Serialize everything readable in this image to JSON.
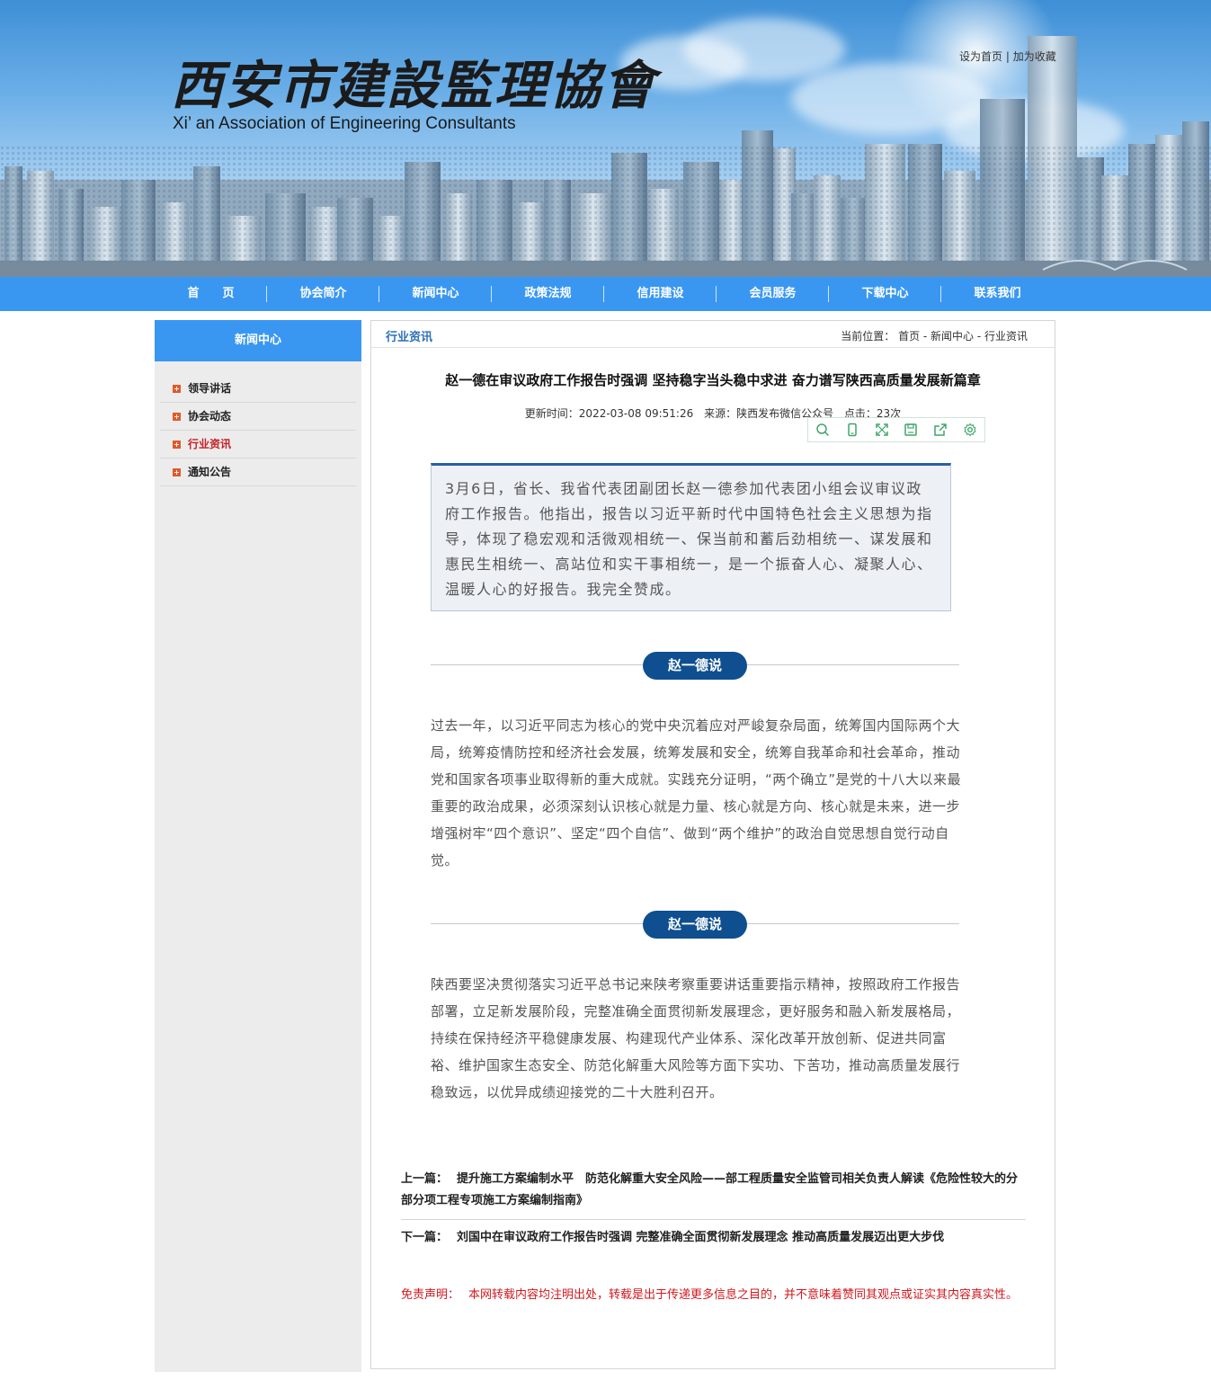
{
  "header": {
    "logo_cn": "西安市建設監理協會",
    "logo_en": "Xi’  an Association of Engineering Consultants",
    "set_home": "设为首页",
    "separator": "|",
    "add_favorite": "加为收藏"
  },
  "nav": {
    "items": [
      "首　　页",
      "协会简介",
      "新闻中心",
      "政策法规",
      "信用建设",
      "会员服务",
      "下载中心",
      "联系我们"
    ]
  },
  "sidebar": {
    "title": "新闻中心",
    "items": [
      {
        "label": "领导讲话",
        "active": false
      },
      {
        "label": "协会动态",
        "active": false
      },
      {
        "label": "行业资讯",
        "active": true
      },
      {
        "label": "通知公告",
        "active": false
      }
    ]
  },
  "main": {
    "section_title": "行业资讯",
    "breadcrumb": "当前位置：  首页 - 新闻中心 - 行业资讯"
  },
  "article": {
    "title": "赵一德在审议政府工作报告时强调 坚持稳字当头稳中求进 奋力谱写陕西高质量发展新篇章",
    "updated": "更新时间：2022-03-08 09:51:26",
    "source": "来源：陕西发布微信公众号",
    "clicks": "点击：23次",
    "lead": "3月6日，省长、我省代表团副团长赵一德参加代表团小组会议审议政府工作报告。他指出，报告以习近平新时代中国特色社会主义思想为指导，体现了稳宏观和活微观相统一、保当前和蓄后劲相统一、谋发展和惠民生相统一、高站位和实干事相统一，是一个振奋人心、凝聚人心、温暖人心的好报告。我完全赞成。",
    "section1_label": "赵一德说",
    "para1": "过去一年，以习近平同志为核心的党中央沉着应对严峻复杂局面，统筹国内国际两个大局，统筹疫情防控和经济社会发展，统筹发展和安全，统筹自我革命和社会革命，推动党和国家各项事业取得新的重大成就。实践充分证明，“两个确立”是党的十八大以来最重要的政治成果，必须深刻认识核心就是力量、核心就是方向、核心就是未来，进一步增强树牢“四个意识”、坚定“四个自信”、做到“两个维护”的政治自觉思想自觉行动自觉。",
    "section2_label": "赵一德说",
    "para2": "陕西要坚决贯彻落实习近平总书记来陕考察重要讲话重要指示精神，按照政府工作报告部署，立足新发展阶段，完整准确全面贯彻新发展理念，更好服务和融入新发展格局，持续在保持经济平稳健康发展、构建现代产业体系、深化改革开放创新、促进共同富裕、维护国家生态安全、防范化解重大风险等方面下实功、下苦功，推动高质量发展行稳致远，以优异成绩迎接党的二十大胜利召开。"
  },
  "share_icons": [
    "search-icon",
    "phone-icon",
    "fullscreen-icon",
    "save-icon",
    "share-icon",
    "settings-icon"
  ],
  "prev": {
    "label": "上一篇：",
    "title": "提升施工方案编制水平　防范化解重大安全风险——部工程质量安全监管司相关负责人解读《危险性较大的分部分项工程专项施工方案编制指南》"
  },
  "next": {
    "label": "下一篇：",
    "title": "刘国中在审议政府工作报告时强调 完整准确全面贯彻新发展理念 推动高质量发展迈出更大步伐"
  },
  "disclaimer": {
    "label": "免责声明：",
    "text": "本网转载内容均注明出处，转载是出于传递更多信息之目的，并不意味着赞同其观点或证实其内容真实性。"
  },
  "colors": {
    "nav_blue": "#3a97f1",
    "section_blue": "#2d6fb6",
    "pill_navy": "#0f4f8f",
    "active_red": "#c62026",
    "disclaimer_red": "#d2171d"
  }
}
